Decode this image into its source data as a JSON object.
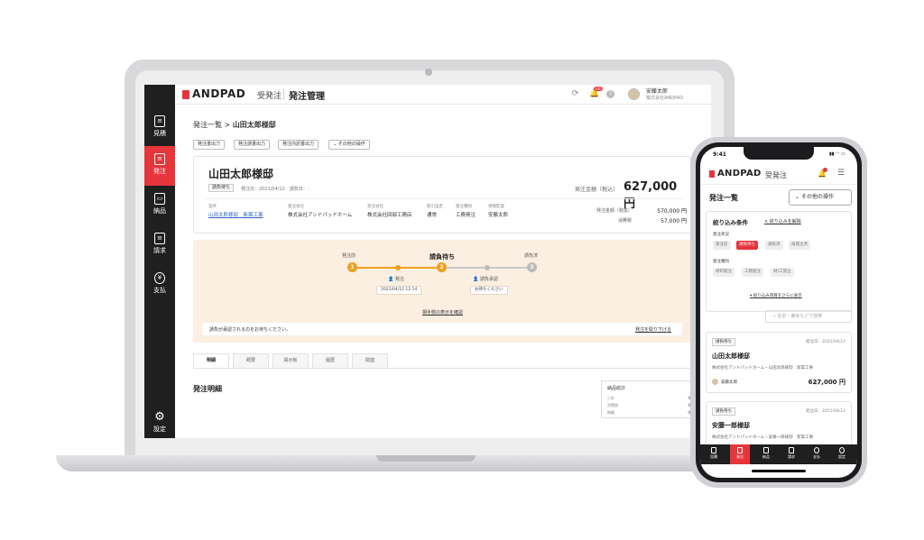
{
  "sidebar": {
    "items": [
      {
        "label": "見積"
      },
      {
        "label": "発注"
      },
      {
        "label": "納品"
      },
      {
        "label": "請求"
      },
      {
        "label": "支払"
      },
      {
        "label": "設定"
      }
    ]
  },
  "header": {
    "brand": "ANDPAD",
    "product": "受発注",
    "page_title": "発注管理",
    "notification_count": "100",
    "user_name": "安藤太郎",
    "user_company": "株式会社ANDPAD"
  },
  "breadcrumb": {
    "parent": "発注一覧",
    "separator": ">",
    "current": "山田太郎様邸"
  },
  "actions": {
    "output_order": "発注書出力",
    "output_receipt": "発注請書出力",
    "output_detail": "発注内訳書出力",
    "other": "その他の操作"
  },
  "order": {
    "title": "山田太郎様邸",
    "status_tag": "請負待ち",
    "order_date": "発注日：2021/04/12",
    "contract_date": "請負日：-",
    "total_label": "発注金額（税込）",
    "total_value": "627,000 円",
    "fields": [
      {
        "key": "案件",
        "value": "山田太郎様邸　新築工事"
      },
      {
        "key": "発注会社",
        "value": "株式会社アンドパッドホーム"
      },
      {
        "key": "受注会社",
        "value": "株式会社回部工務店"
      },
      {
        "key": "取引設定",
        "value": "通常"
      },
      {
        "key": "発注種別",
        "value": "工務発注"
      },
      {
        "key": "現場監督",
        "value": "安藤太郎"
      }
    ],
    "amount_excl_label": "発注金額（税抜）",
    "amount_excl_value": "570,000 円",
    "tax_label": "消費税",
    "tax_value": "57,000 円"
  },
  "status": {
    "title": "請負待ち",
    "step_before": "発注前",
    "step_done": "請負済",
    "step1_num": "1",
    "step2_num": "2",
    "step3_num": "3",
    "step1_label": "発注",
    "step1_date": "2021/04/12 12:14",
    "step2_label": "請負承認",
    "step2_note": "お待ちください",
    "partner_link": "相手側の表示を確認",
    "message": "請負が承認されるのをお待ちください。",
    "withdraw_link": "発注を取り下げる"
  },
  "tabs": [
    {
      "label": "明細"
    },
    {
      "label": "概要"
    },
    {
      "label": "掲示板"
    },
    {
      "label": "履歴"
    },
    {
      "label": "関連"
    }
  ],
  "detail": {
    "section_title": "発注明細",
    "summary_title": "納品総計",
    "rows": [
      {
        "label": "小計",
        "value": "0円"
      },
      {
        "label": "消費税",
        "value": "0円"
      },
      {
        "label": "総額",
        "value": "0円"
      }
    ]
  },
  "phone": {
    "time": "9:41",
    "brand": "ANDPAD",
    "product": "受発注",
    "page_title": "発注一覧",
    "other_actions": "その他の操作",
    "filter_title": "絞り込み条件",
    "filter_clear": "絞り込みを解除",
    "status_label": "発注状況",
    "status_chips": [
      {
        "label": "発注前",
        "active": false
      },
      {
        "label": "請負待ち",
        "active": true
      },
      {
        "label": "請負済",
        "active": false
      },
      {
        "label": "再発注済",
        "active": false
      }
    ],
    "type_label": "発注種別",
    "type_chips": [
      {
        "label": "材料発注"
      },
      {
        "label": "工務発注"
      },
      {
        "label": "材/工発注"
      }
    ],
    "more_filters": "絞り込み項目をさらに表示",
    "search_placeholder": "名前・備考などで検索",
    "cards": [
      {
        "tag": "請負待ち",
        "date": "発注日：2021/04/12",
        "title": "山田太郎様邸",
        "subtitle": "株式会社アンドパッドホーム・山田太郎様邸　新築工事",
        "person": "安藤太郎",
        "price_label": "税込",
        "price": "627,000 円"
      },
      {
        "tag": "請負待ち",
        "date": "発注日：2021/04/12",
        "title": "安藤一郎様邸",
        "subtitle": "株式会社アンドパッドホーム・安藤一郎様邸　新築工事"
      }
    ],
    "nav": [
      {
        "label": "見積"
      },
      {
        "label": "発注"
      },
      {
        "label": "納品"
      },
      {
        "label": "請求"
      },
      {
        "label": "支払"
      },
      {
        "label": "設定"
      }
    ]
  }
}
